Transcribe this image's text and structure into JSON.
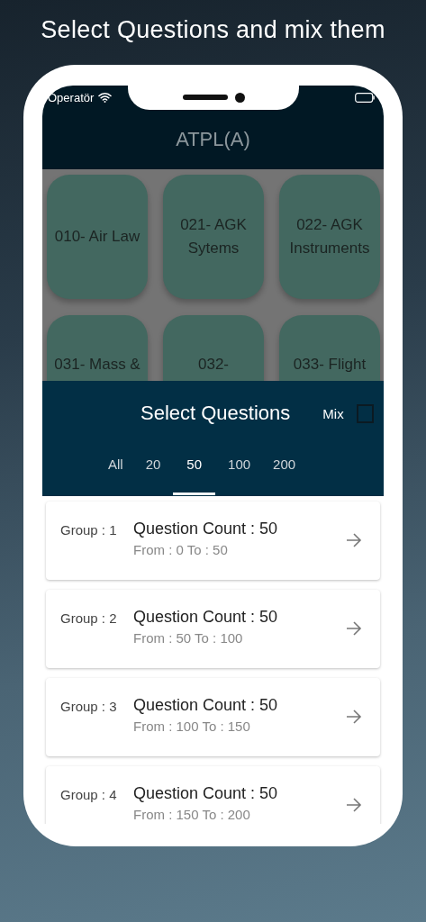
{
  "headline": "Select Questions and mix them",
  "status_bar": {
    "carrier": "Operatör"
  },
  "app_bar": {
    "title": "ATPL(A)"
  },
  "subjects": [
    {
      "label": "010- Air Law"
    },
    {
      "label": "021- AGK Sytems"
    },
    {
      "label": "022- AGK Instruments"
    },
    {
      "label": "031- Mass &"
    },
    {
      "label": "032-"
    },
    {
      "label": "033- Flight"
    }
  ],
  "sheet": {
    "title": "Select Questions",
    "mix": {
      "label": "Mix",
      "checked": false
    },
    "tabs": [
      {
        "label": "All",
        "selected": false
      },
      {
        "label": "20",
        "selected": false
      },
      {
        "label": "50",
        "selected": true
      },
      {
        "label": "100",
        "selected": false
      },
      {
        "label": "200",
        "selected": false
      }
    ]
  },
  "groups": [
    {
      "group": "Group : 1",
      "count": "Question Count : 50",
      "range": "From : 0 To : 50"
    },
    {
      "group": "Group : 2",
      "count": "Question Count : 50",
      "range": "From : 50 To : 100"
    },
    {
      "group": "Group : 3",
      "count": "Question Count : 50",
      "range": "From : 100 To : 150"
    },
    {
      "group": "Group : 4",
      "count": "Question Count : 50",
      "range": "From : 150 To : 200"
    }
  ]
}
